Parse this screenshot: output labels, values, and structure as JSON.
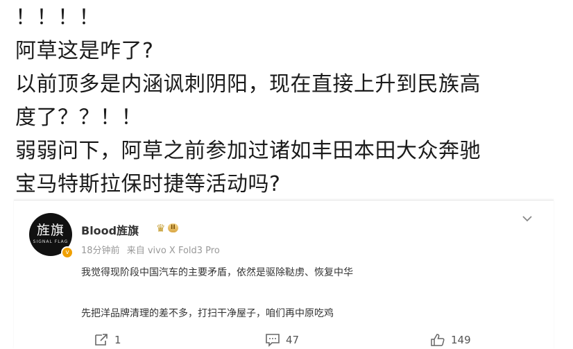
{
  "post": {
    "lines": [
      "！！！！",
      "阿草这是咋了?",
      "以前顶多是内涵讽刺阴阳，现在直接上升到民族高",
      "度了？？！！",
      "弱弱问下，阿草之前参加过诸如丰田本田大众奔驰",
      "宝马特斯拉保时捷等活动吗?"
    ]
  },
  "card": {
    "avatar_text": "旌旗",
    "avatar_subtext": "SIGNAL FLAG",
    "username": "Blood旌旗",
    "vip_level": "II",
    "time": "18分钟前",
    "source": "来自 vivo X Fold3 Pro",
    "body_lines": [
      "我觉得现阶段中国汽车的主要矛盾，依然是驱除鞑虏、恢复中华",
      "先把洋品牌清理的差不多，打扫干净屋子，咱们再中原吃鸡"
    ],
    "actions": {
      "repost_count": "1",
      "comment_count": "47",
      "like_count": "149"
    }
  },
  "icons": {
    "repost": "repost-icon",
    "comment": "comment-icon",
    "like": "thumbs-up-icon",
    "menu": "chevron-down-icon",
    "verified": "verified-badge-icon",
    "vip": "crown-icon"
  },
  "colors": {
    "text": "#1b1b1b",
    "meta": "#999999",
    "vip_gold": "#d9a745",
    "badge": "#f0a000"
  }
}
